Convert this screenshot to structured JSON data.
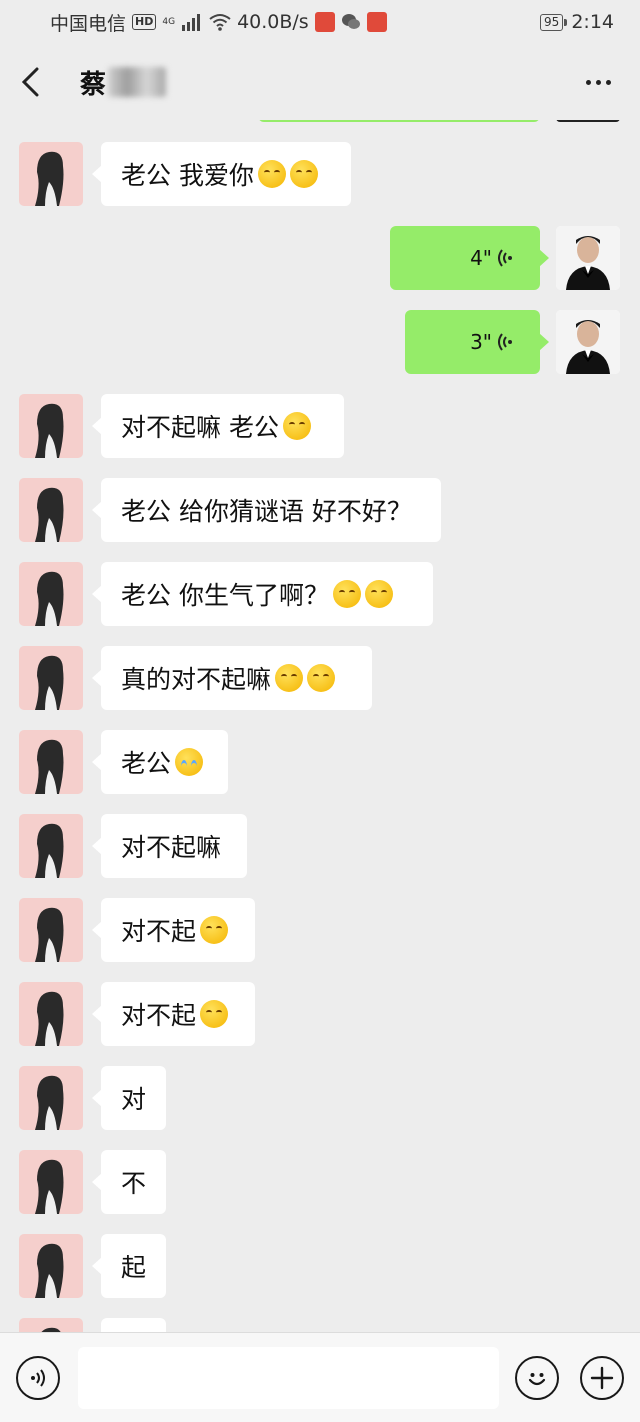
{
  "status_bar": {
    "carrier": "中国电信",
    "hd": "HD",
    "network": "4G",
    "speed": "40.0B/s",
    "battery": "95",
    "time": "2:14"
  },
  "nav": {
    "title": "蔡"
  },
  "messages": [
    {
      "from": "her",
      "text": "老公 我爱你",
      "emojis": [
        "kiss-emoji",
        "kiss-emoji"
      ]
    },
    {
      "from": "me",
      "text": "4\""
    },
    {
      "from": "me",
      "text": "3\""
    },
    {
      "from": "her",
      "text": "对不起嘛 老公",
      "emojis": [
        "pleading-emoji"
      ]
    },
    {
      "from": "her",
      "text": "老公 给你猜谜语 好不好？",
      "emojis": []
    },
    {
      "from": "her",
      "text": "老公 你生气了啊？",
      "emojis": [
        "pleading-emoji",
        "pleading-emoji"
      ]
    },
    {
      "from": "her",
      "text": "真的对不起嘛",
      "emojis": [
        "pleading-emoji",
        "pleading-emoji"
      ]
    },
    {
      "from": "her",
      "text": "老公",
      "emojis": [
        "crying-emoji"
      ]
    },
    {
      "from": "her",
      "text": "对不起嘛",
      "emojis": []
    },
    {
      "from": "her",
      "text": "对不起",
      "emojis": [
        "pleading-emoji"
      ]
    },
    {
      "from": "her",
      "text": "对不起",
      "emojis": [
        "pleading-emoji"
      ]
    },
    {
      "from": "her",
      "text": "对",
      "emojis": []
    },
    {
      "from": "her",
      "text": "不",
      "emojis": []
    },
    {
      "from": "her",
      "text": "起",
      "emojis": []
    }
  ],
  "colors": {
    "background": "#ededed",
    "bubble_out": "#95ec69",
    "bubble_in": "#ffffff",
    "her_avatar_bg": "#f5cfcc"
  },
  "icons": {
    "back": "chevron-left-icon",
    "more": "more-dots-icon",
    "voice_toggle": "voice-mode-icon",
    "emoji": "emoji-icon",
    "plus": "plus-icon"
  }
}
